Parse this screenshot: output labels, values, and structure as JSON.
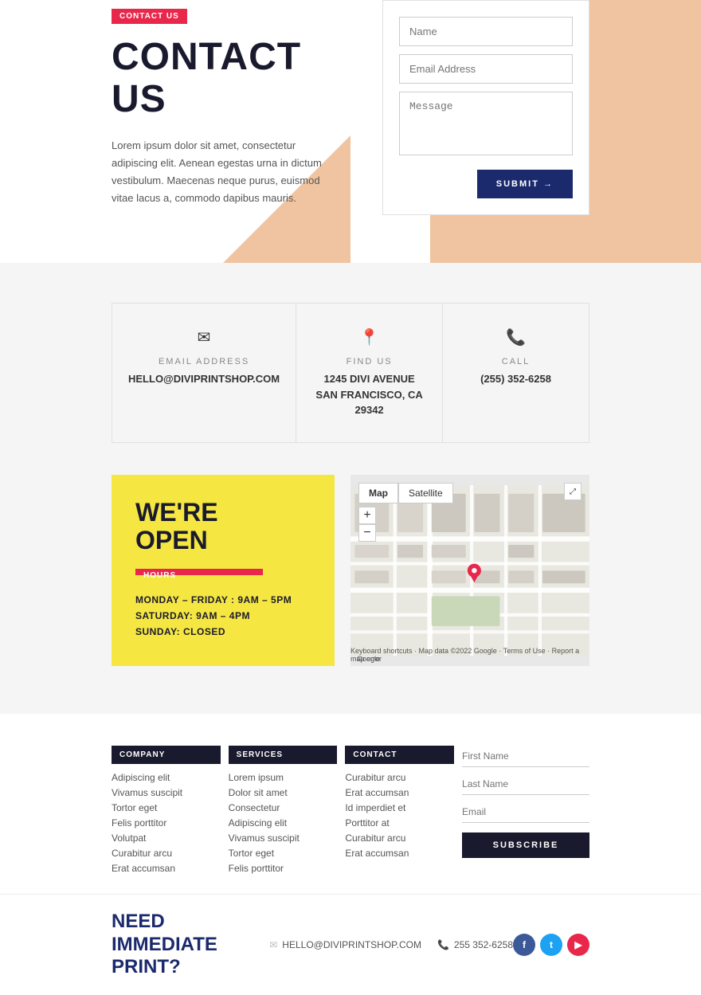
{
  "hero": {
    "badge": "CONTACT US",
    "title": "CONTACT US",
    "description": "Lorem ipsum dolor sit amet, consectetur adipiscing elit. Aenean egestas urna in dictum vestibulum. Maecenas neque purus, euismod vitae lacus a, commodo dapibus mauris.",
    "form": {
      "name_placeholder": "Name",
      "email_placeholder": "Email Address",
      "message_placeholder": "Message",
      "submit_label": "SUBMIT →"
    }
  },
  "contact_info": {
    "items": [
      {
        "icon": "✉",
        "label": "EMAIL ADDRESS",
        "value": "HELLO@DIVIPRINTSHOP.COM"
      },
      {
        "icon": "📍",
        "label": "FIND US",
        "value": "1245 DIVI AVENUE\nSAN FRANCISCO, CA 29342"
      },
      {
        "icon": "📞",
        "label": "CALL",
        "value": "(255) 352-6258"
      }
    ]
  },
  "hours": {
    "title": "WE'RE OPEN",
    "badge_label": "HOURS",
    "schedule": [
      "MONDAY – FRIDAY : 9AM – 5PM",
      "SATURDAY: 9AM – 4PM",
      "SUNDAY: CLOSED"
    ]
  },
  "map": {
    "tab_map": "Map",
    "tab_satellite": "Satellite"
  },
  "footer": {
    "columns": [
      {
        "header": "COMPANY",
        "items": [
          "Adipiscing elit",
          "Vivamus suscipit",
          "Tortor eget",
          "Felis porttitor",
          "Volutpat",
          "Curabitur arcu",
          "Erat accumsan"
        ]
      },
      {
        "header": "SERVICES",
        "items": [
          "Lorem ipsum",
          "Dolor sit amet",
          "Consectetur",
          "Adipiscing elit",
          "Vivamus suscipit",
          "Tortor eget",
          "Felis porttitor"
        ]
      },
      {
        "header": "CONTACT",
        "items": [
          "Curabitur arcu",
          "Erat accumsan",
          "Id imperdiet et",
          "Porttitor at",
          "Curabitur arcu",
          "Erat accumsan"
        ]
      }
    ],
    "newsletter": {
      "first_name_placeholder": "First Name",
      "last_name_placeholder": "Last Name",
      "email_placeholder": "Email",
      "subscribe_label": "SUBSCRIBE"
    }
  },
  "bottom_bar": {
    "need_print": "NEED IMMEDIATE\nPRINT?",
    "email": "HELLO@DIVIPRINTSHOP.COM",
    "phone": "255 352-6258",
    "socials": [
      {
        "icon": "f",
        "label": "facebook",
        "color_class": "social-fb"
      },
      {
        "icon": "t",
        "label": "twitter",
        "color_class": "social-tw"
      },
      {
        "icon": "▶",
        "label": "youtube",
        "color_class": "social-yt"
      }
    ]
  }
}
